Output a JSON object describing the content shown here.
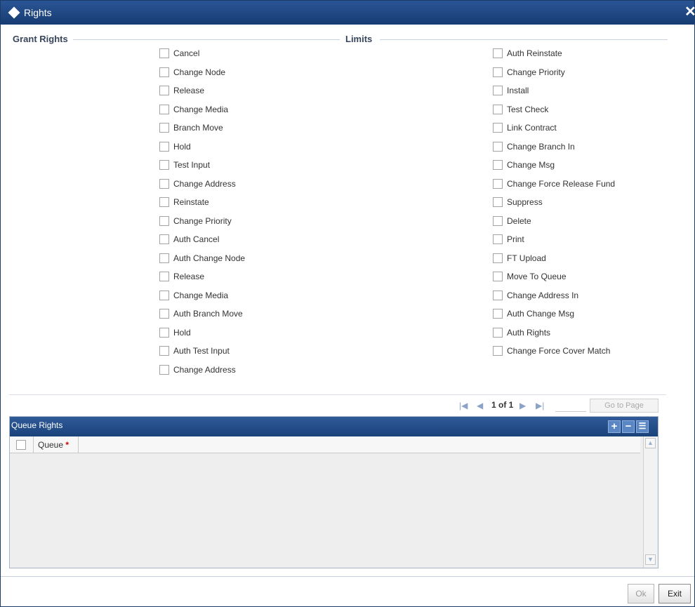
{
  "window": {
    "title": "Rights",
    "close_glyph": "✕"
  },
  "sections": {
    "grant_rights": "Grant Rights",
    "limits": "Limits"
  },
  "left_checks": [
    {
      "label": "Cancel",
      "checked": false
    },
    {
      "label": "Change Node",
      "checked": false
    },
    {
      "label": "Release",
      "checked": false
    },
    {
      "label": "Change Media",
      "checked": false
    },
    {
      "label": "Branch Move",
      "checked": false
    },
    {
      "label": "Hold",
      "checked": false
    },
    {
      "label": "Test Input",
      "checked": false
    },
    {
      "label": "Change Address",
      "checked": false
    },
    {
      "label": "Reinstate",
      "checked": false
    },
    {
      "label": "Change Priority",
      "checked": false
    },
    {
      "label": "Auth Cancel",
      "checked": false
    },
    {
      "label": "Auth Change Node",
      "checked": false
    },
    {
      "label": "Release",
      "checked": false
    },
    {
      "label": "Change Media",
      "checked": false
    },
    {
      "label": "Auth Branch Move",
      "checked": false
    },
    {
      "label": "Hold",
      "checked": false
    },
    {
      "label": "Auth Test Input",
      "checked": false
    },
    {
      "label": "Change Address",
      "checked": false
    }
  ],
  "right_checks": [
    {
      "label": "Auth Reinstate",
      "checked": false
    },
    {
      "label": "Change Priority",
      "checked": false
    },
    {
      "label": "Install",
      "checked": false
    },
    {
      "label": "Test Check",
      "checked": false
    },
    {
      "label": "Link Contract",
      "checked": false
    },
    {
      "label": "Change Branch In",
      "checked": false
    },
    {
      "label": "Change Msg",
      "checked": false
    },
    {
      "label": "Change Force Release Fund",
      "checked": false
    },
    {
      "label": "Suppress",
      "checked": false
    },
    {
      "label": "Delete",
      "checked": false
    },
    {
      "label": "Print",
      "checked": false
    },
    {
      "label": "FT Upload",
      "checked": false
    },
    {
      "label": "Move To Queue",
      "checked": false
    },
    {
      "label": "Change Address In",
      "checked": false
    },
    {
      "label": "Auth Change Msg",
      "checked": false
    },
    {
      "label": "Auth Rights",
      "checked": false
    },
    {
      "label": "Change Force Cover Match",
      "checked": false
    }
  ],
  "pagination": {
    "first_icon": "first-page-icon",
    "prev_icon": "prev-page-icon",
    "text": "1 of 1",
    "next_icon": "next-page-icon",
    "last_icon": "last-page-icon",
    "page_input": "",
    "goto_label": "Go to Page"
  },
  "queue_grid": {
    "title": "Queue Rights",
    "column": "Queue",
    "required_mark": "*",
    "add_icon": "add-row-icon",
    "delete_icon": "delete-row-icon",
    "view_icon": "single-view-icon",
    "rows": []
  },
  "footer": {
    "ok_label": "Ok",
    "exit_label": "Exit"
  },
  "colors": {
    "title_bar": "#1f4680",
    "accent_icon": "#8aa3c7",
    "required": "#d00000"
  }
}
